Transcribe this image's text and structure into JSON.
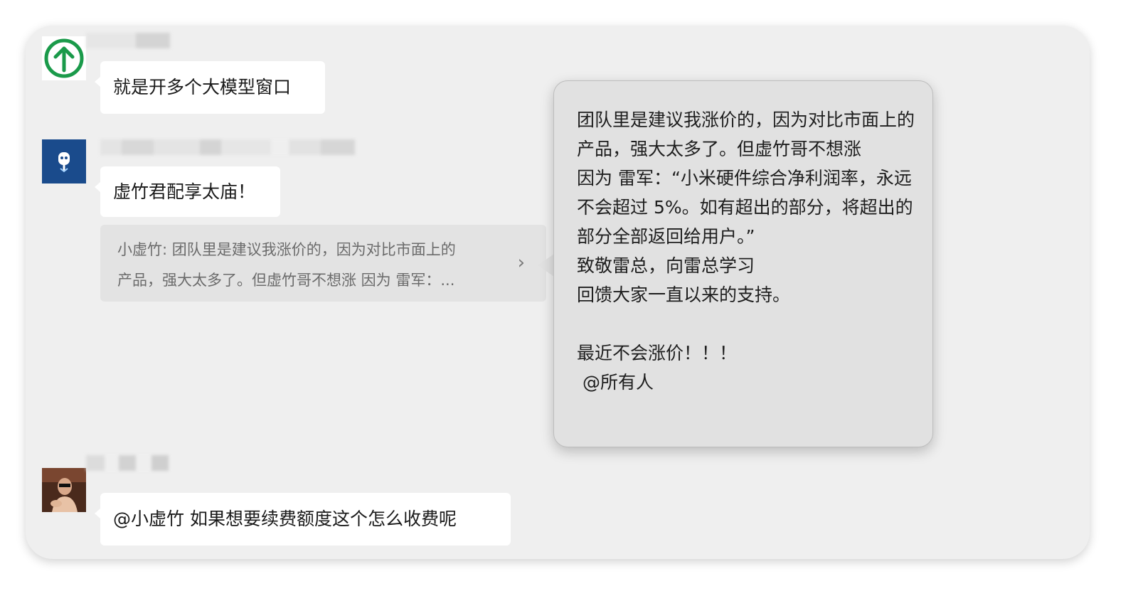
{
  "messages": [
    {
      "text": "就是开多个大模型窗口"
    },
    {
      "text": "虚竹君配享太庙！"
    },
    {
      "text": "@小虚竹 如果想要续费额度这个怎么收费呢"
    }
  ],
  "quote": {
    "line1": "小虚竹: 团队里是建议我涨价的，因为对比市面上的",
    "line2": "产品，强大太多了。但虚竹哥不想涨 因为 雷军：...",
    "chevron": "›"
  },
  "popup": {
    "text": "团队里是建议我涨价的，因为对比市面上的产品，强大太多了。但虚竹哥不想涨\n因为 雷军：“小米硬件综合净利润率，永远不会超过 5%。如有超出的部分，将超出的部分全部返回给用户。”\n致敬雷总，向雷总学习\n回馈大家一直以来的支持。\n\n最近不会涨价！！！\n @所有人"
  },
  "colors": {
    "window_bg": "#efefef",
    "bubble_bg": "#ffffff",
    "quote_bg": "#e3e3e3",
    "popup_bg": "#e1e1e1",
    "avatar1_ring": "#1a9a4a",
    "avatar2_bg": "#1a4b8c"
  },
  "icons": {
    "avatar1": "up-arrow-circle-icon",
    "avatar2": "robot-icon",
    "avatar3": "user-photo"
  }
}
